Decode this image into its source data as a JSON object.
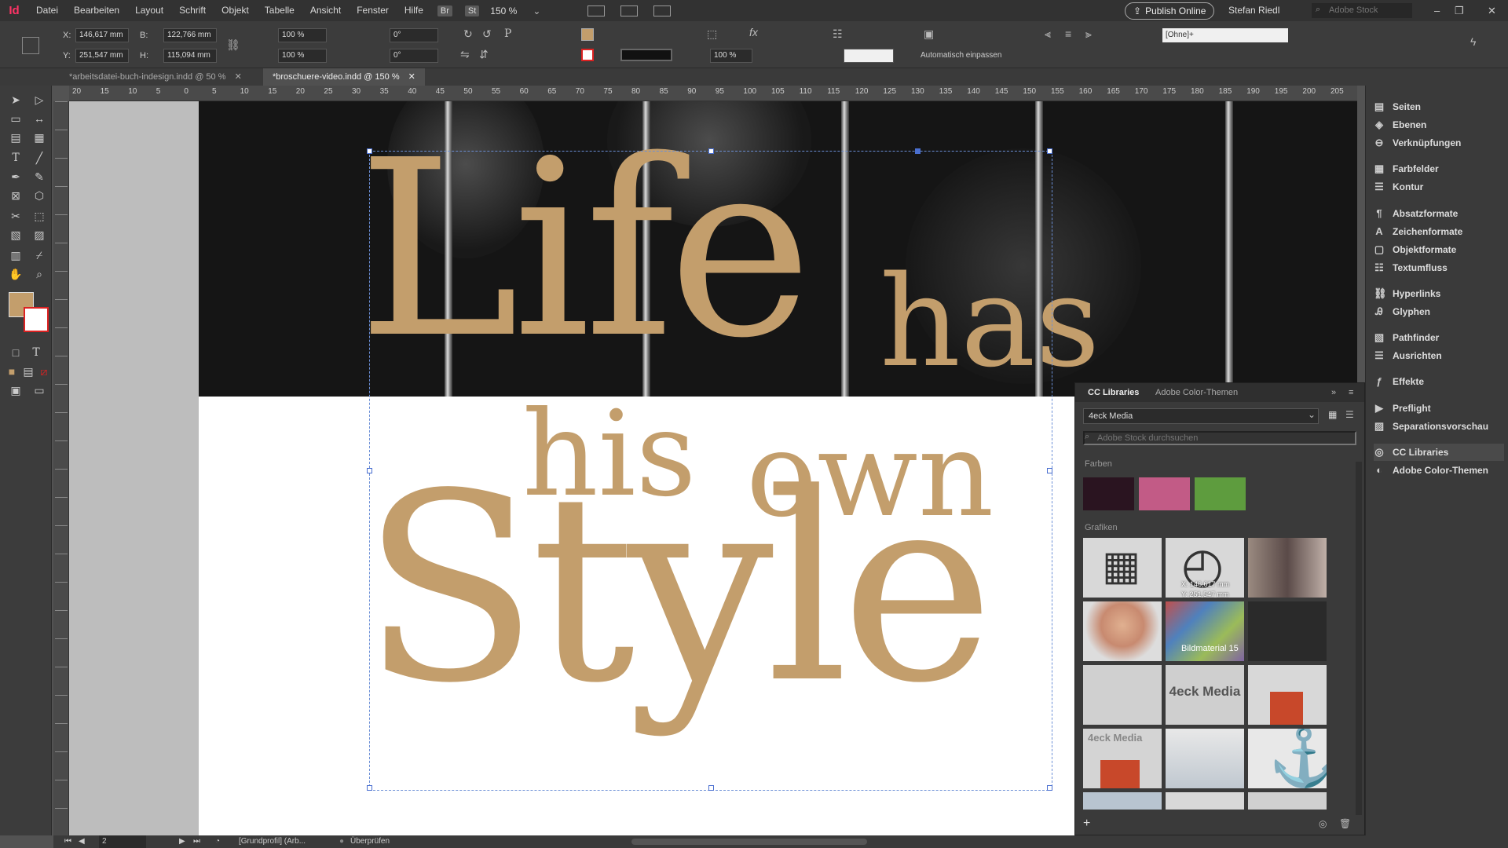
{
  "menubar": {
    "logo": "Id",
    "items": [
      "Datei",
      "Bearbeiten",
      "Layout",
      "Schrift",
      "Objekt",
      "Tabelle",
      "Ansicht",
      "Fenster",
      "Hilfe"
    ],
    "badges": [
      "Br",
      "St"
    ],
    "zoom": "150 %",
    "publish_label": "Publish Online",
    "user": "Stefan Riedl",
    "stock_placeholder": "Adobe Stock"
  },
  "controlbar": {
    "x_label": "X:",
    "x_value": "146,617 mm",
    "y_label": "Y:",
    "y_value": "251,547 mm",
    "w_label": "B:",
    "w_value": "122,766 mm",
    "h_label": "H:",
    "h_value": "115,094 mm",
    "scale_x": "100 %",
    "scale_y": "100 %",
    "rotate": "0°",
    "shear": "0°",
    "opacity": "100 %",
    "object_style": "[Ohne]+",
    "autofit_label": "Automatisch einpassen",
    "fill_color": "#c39e6c"
  },
  "tabs": [
    {
      "label": "*arbeitsdatei-buch-indesign.indd @ 50 %"
    },
    {
      "label": "*broschuere-video.indd @ 150 %"
    }
  ],
  "ruler": {
    "h_ticks": [
      "20",
      "15",
      "10",
      "5",
      "0",
      "5",
      "10",
      "15",
      "20",
      "25",
      "30",
      "35",
      "40",
      "45",
      "50",
      "55",
      "60",
      "65",
      "70",
      "75",
      "80",
      "85",
      "90",
      "95",
      "100",
      "105",
      "110",
      "115",
      "120",
      "125",
      "130",
      "135",
      "140",
      "145",
      "150",
      "155",
      "160",
      "165",
      "170",
      "175",
      "180",
      "185",
      "190",
      "195",
      "200",
      "205"
    ]
  },
  "page": {
    "words": {
      "life": "Life",
      "has": "has",
      "his": "his",
      "own": "own",
      "style": "Style"
    },
    "text_color": "#c39e6c"
  },
  "statusbar": {
    "page_number": "2",
    "profile": "[Grundprofil] (Arb...",
    "preflight": "Überprüfen"
  },
  "dock": {
    "items": [
      {
        "label": "Seiten",
        "icon": "pages-icon"
      },
      {
        "label": "Ebenen",
        "icon": "layers-icon"
      },
      {
        "label": "Verknüpfungen",
        "icon": "links-icon"
      },
      {
        "label": "Farbfelder",
        "icon": "swatches-icon"
      },
      {
        "label": "Kontur",
        "icon": "stroke-icon"
      },
      {
        "label": "Absatzformate",
        "icon": "paragraph-styles-icon"
      },
      {
        "label": "Zeichenformate",
        "icon": "character-styles-icon"
      },
      {
        "label": "Objektformate",
        "icon": "object-styles-icon"
      },
      {
        "label": "Textumfluss",
        "icon": "text-wrap-icon"
      },
      {
        "label": "Hyperlinks",
        "icon": "hyperlinks-icon"
      },
      {
        "label": "Glyphen",
        "icon": "glyphs-icon"
      },
      {
        "label": "Pathfinder",
        "icon": "pathfinder-icon"
      },
      {
        "label": "Ausrichten",
        "icon": "align-icon"
      },
      {
        "label": "Effekte",
        "icon": "effects-icon"
      },
      {
        "label": "Preflight",
        "icon": "preflight-icon"
      },
      {
        "label": "Separationsvorschau",
        "icon": "separations-icon"
      },
      {
        "label": "CC Libraries",
        "icon": "cc-libraries-icon"
      },
      {
        "label": "Adobe Color-Themen",
        "icon": "color-themes-icon"
      }
    ]
  },
  "libraries": {
    "tab_active": "CC Libraries",
    "tab_other": "Adobe Color-Themen",
    "library_name": "4eck Media",
    "search_placeholder": "Adobe Stock durchsuchen",
    "colors_heading": "Farben",
    "graphics_heading": "Grafiken",
    "colors": [
      "#2a1420",
      "#c25b86",
      "#5e9c3e"
    ],
    "graphic_labels": {
      "bildmaterial": "Bildmaterial 15",
      "logo_text": "4eck Media",
      "logo_small": "4eck Media"
    },
    "tooltip_x": "X: 146,617 mm",
    "tooltip_y": "Y: 251,547 mm"
  }
}
